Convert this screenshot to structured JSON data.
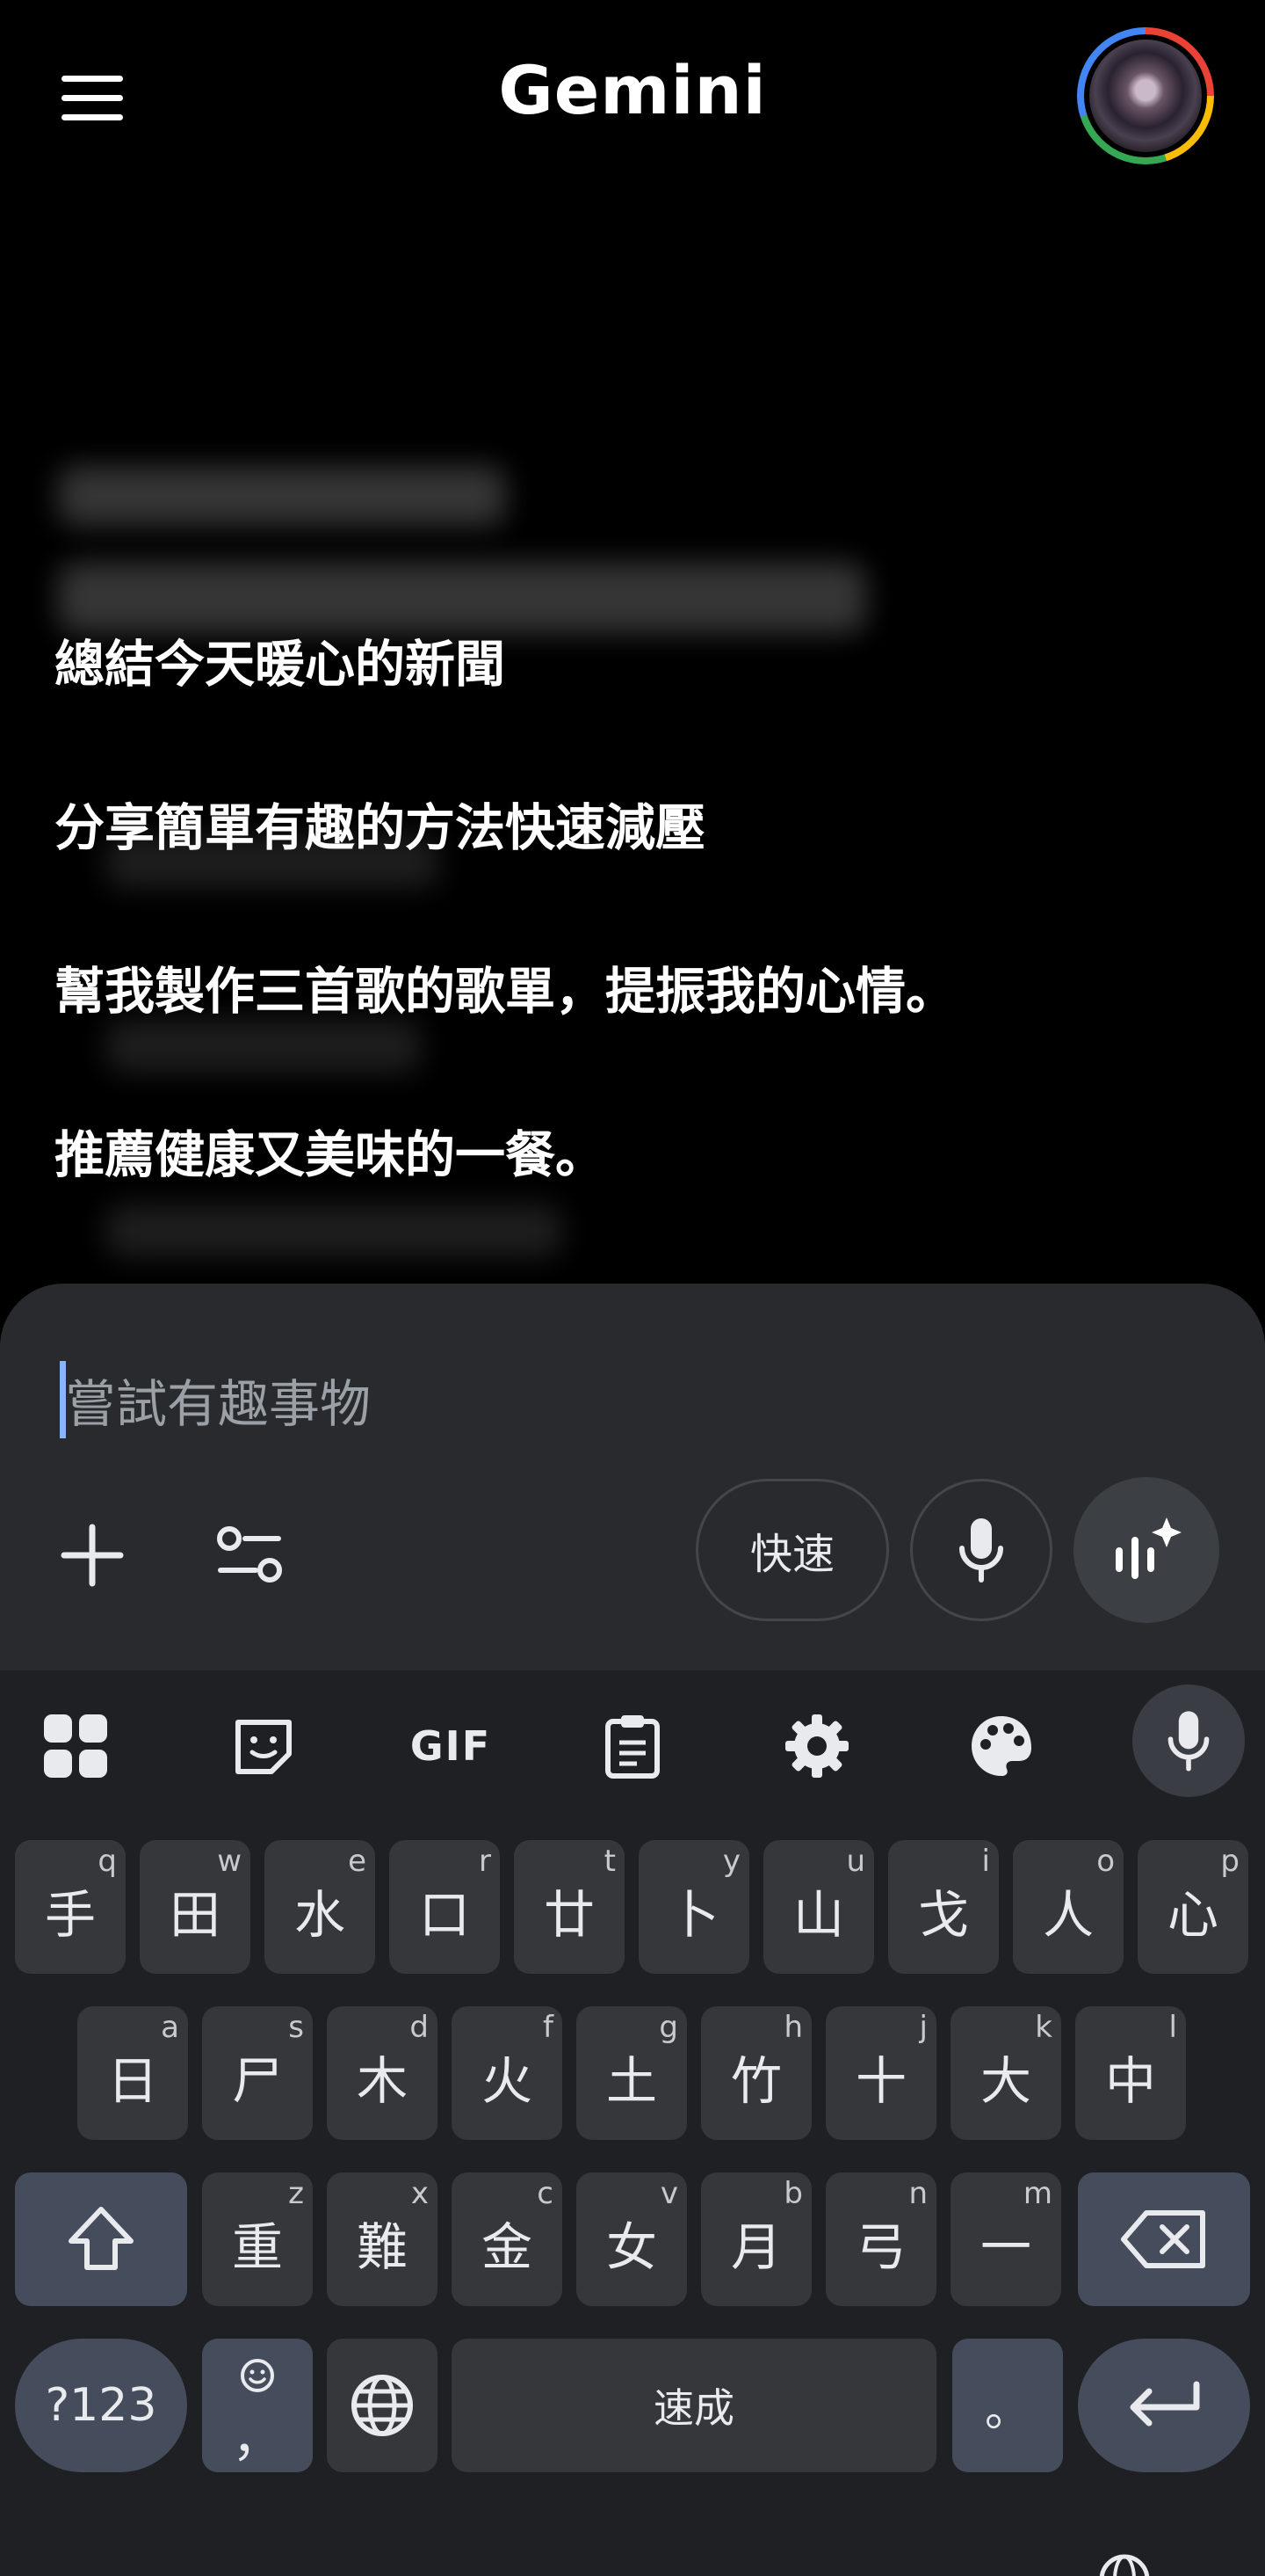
{
  "header": {
    "title": "Gemini",
    "menu_icon": "menu-icon",
    "avatar": "avatar"
  },
  "suggestions": [
    "總結今天暖心的新聞",
    "分享簡單有趣的方法快速減壓",
    "幫我製作三首歌的歌單，提振我的心情。",
    "推薦健康又美味的一餐。"
  ],
  "composer": {
    "placeholder": "嘗試有趣事物",
    "add_icon": "plus-icon",
    "tools_icon": "tune-icon",
    "mode_label": "快速",
    "mic_icon": "mic-icon",
    "live_icon": "live-spark-icon"
  },
  "keyboard": {
    "toolbar": {
      "apps_icon": "apps-grid-icon",
      "sticker_icon": "sticker-icon",
      "gif_label": "GIF",
      "clipboard_icon": "clipboard-icon",
      "settings_icon": "gear-icon",
      "theme_icon": "palette-icon",
      "voice_icon": "mic-icon"
    },
    "row1": [
      {
        "main": "手",
        "sub": "q"
      },
      {
        "main": "田",
        "sub": "w"
      },
      {
        "main": "水",
        "sub": "e"
      },
      {
        "main": "口",
        "sub": "r"
      },
      {
        "main": "廿",
        "sub": "t"
      },
      {
        "main": "卜",
        "sub": "y"
      },
      {
        "main": "山",
        "sub": "u"
      },
      {
        "main": "戈",
        "sub": "i"
      },
      {
        "main": "人",
        "sub": "o"
      },
      {
        "main": "心",
        "sub": "p"
      }
    ],
    "row2": [
      {
        "main": "日",
        "sub": "a"
      },
      {
        "main": "尸",
        "sub": "s"
      },
      {
        "main": "木",
        "sub": "d"
      },
      {
        "main": "火",
        "sub": "f"
      },
      {
        "main": "土",
        "sub": "g"
      },
      {
        "main": "竹",
        "sub": "h"
      },
      {
        "main": "十",
        "sub": "j"
      },
      {
        "main": "大",
        "sub": "k"
      },
      {
        "main": "中",
        "sub": "l"
      }
    ],
    "row3": [
      {
        "main": "重",
        "sub": "z"
      },
      {
        "main": "難",
        "sub": "x"
      },
      {
        "main": "金",
        "sub": "c"
      },
      {
        "main": "女",
        "sub": "v"
      },
      {
        "main": "月",
        "sub": "b"
      },
      {
        "main": "弓",
        "sub": "n"
      },
      {
        "main": "一",
        "sub": "m"
      }
    ],
    "shift_icon": "shift-icon",
    "backspace_icon": "backspace-icon",
    "symbols_label": "?123",
    "emoji_comma_main": "，",
    "emoji_icon": "emoji-icon",
    "globe_icon": "globe-icon",
    "space_label": "速成",
    "period_label": "。",
    "enter_icon": "enter-icon"
  },
  "colors": {
    "background": "#000000",
    "sheet": "#282a2d",
    "keyboard": "#1f2024",
    "key": "#35373b",
    "key_dark": "#454c5c",
    "caret": "#8ab4f8"
  }
}
